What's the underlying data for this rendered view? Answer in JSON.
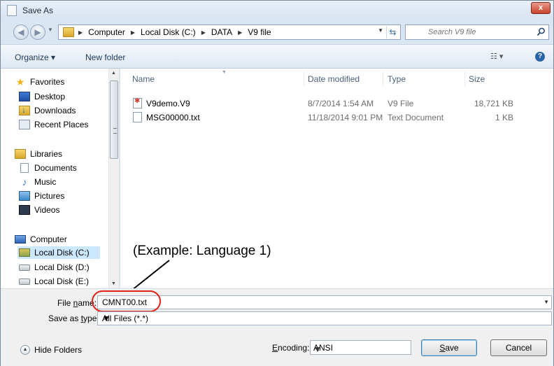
{
  "window": {
    "title": "Save As",
    "close_label": "x"
  },
  "address": {
    "crumbs": [
      "Computer",
      "Local Disk (C:)",
      "DATA",
      "V9 file"
    ],
    "search_placeholder": "Search V9 file"
  },
  "toolbar": {
    "organize_label": "Organize ▾",
    "new_folder_label": "New folder",
    "view_label": "☷ ▾",
    "help_label": "?"
  },
  "nav": {
    "favorites": "Favorites",
    "desktop": "Desktop",
    "downloads": "Downloads",
    "recent": "Recent Places",
    "libraries": "Libraries",
    "documents": "Documents",
    "music": "Music",
    "pictures": "Pictures",
    "videos": "Videos",
    "computer": "Computer",
    "disk_c": "Local Disk (C:)",
    "disk_d": "Local Disk (D:)",
    "disk_e": "Local Disk (E:)"
  },
  "columns": {
    "name": "Name",
    "date": "Date modified",
    "type": "Type",
    "size": "Size"
  },
  "files": [
    {
      "name": "V9demo.V9",
      "date": "8/7/2014 1:54 AM",
      "type": "V9 File",
      "size": "18,721 KB"
    },
    {
      "name": "MSG00000.txt",
      "date": "11/18/2014 9:01 PM",
      "type": "Text Document",
      "size": "1 KB"
    }
  ],
  "callout": "(Example: Language 1)",
  "form": {
    "filename_label_pre": "File ",
    "filename_label_ul": "n",
    "filename_label_post": "ame:",
    "filename_value": "CMNT00.txt",
    "type_label_pre": "Save as ",
    "type_label_ul": "t",
    "type_label_post": "ype:",
    "type_value": "All Files  (*.*)"
  },
  "footer": {
    "hide_folders": "Hide Folders",
    "encoding_label_ul": "E",
    "encoding_label_rest": "ncoding:",
    "encoding_value": "ANSI",
    "save_ul": "S",
    "save_rest": "ave",
    "cancel": "Cancel"
  }
}
